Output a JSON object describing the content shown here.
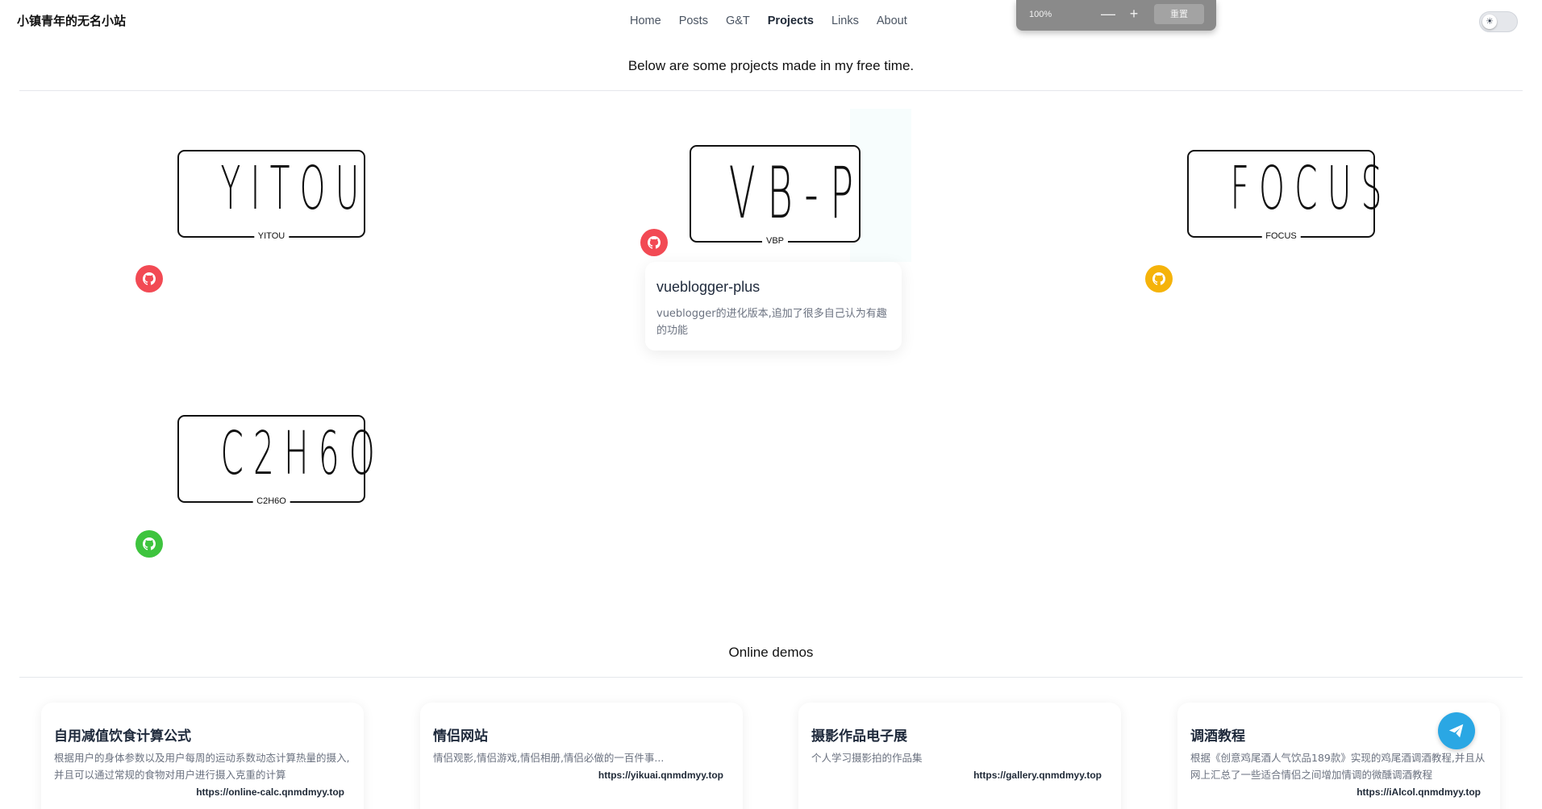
{
  "header": {
    "brand": "小镇青年的无名小站",
    "nav": [
      {
        "label": "Home",
        "active": false
      },
      {
        "label": "Posts",
        "active": false
      },
      {
        "label": "G&T",
        "active": false
      },
      {
        "label": "Projects",
        "active": true
      },
      {
        "label": "Links",
        "active": false
      },
      {
        "label": "About",
        "active": false
      }
    ],
    "theme_toggle_icon": "sun-icon"
  },
  "zoom_toolbar": {
    "level": "100%",
    "minus": "—",
    "plus": "+",
    "reset_label": "重置"
  },
  "projects_section": {
    "heading": "Below are some projects made in my free time.",
    "items": [
      {
        "plate_text": "YITOU",
        "caption": "YITOU",
        "github_color": "#f24a54"
      },
      {
        "plate_text": "VB-P",
        "caption": "VBP",
        "github_color": "#f24a54"
      },
      {
        "plate_text": "FOCUS",
        "caption": "FOCUS",
        "github_color": "#f5b30a"
      },
      {
        "plate_text": "C2H6O",
        "caption": "C2H6O",
        "github_color": "#3ec43e"
      }
    ],
    "hover_card": {
      "title": "vueblogger-plus",
      "description": "vueblogger的进化版本,追加了很多自己认为有趣的功能"
    }
  },
  "demos_section": {
    "heading": "Online demos",
    "items": [
      {
        "title": "自用减值饮食计算公式",
        "description": "根据用户的身体参数以及用户每周的运动系数动态计算热量的摄入,并且可以通过常规的食物对用户进行摄入克重的计算",
        "url": "https://online-calc.qnmdmyy.top"
      },
      {
        "title": "情侣网站",
        "description": "情侣观影,情侣游戏,情侣相册,情侣必做的一百件事...",
        "url": "https://yikuai.qnmdmyy.top"
      },
      {
        "title": "摄影作品电子展",
        "description": "个人学习摄影拍的作品集",
        "url": "https://gallery.qnmdmyy.top"
      },
      {
        "title": "调酒教程",
        "description": "根据《创意鸡尾酒人气饮品189款》实现的鸡尾酒调酒教程,并且从网上汇总了一些适合情侣之间增加情调的微醺调酒教程",
        "url": "https://iAlcol.qnmdmyy.top"
      }
    ]
  },
  "fab_icon": "send-icon",
  "colors": {
    "accent_blue": "#2aa7e4",
    "github_red": "#f24a54",
    "github_yellow": "#f5b30a",
    "github_green": "#3ec43e"
  }
}
